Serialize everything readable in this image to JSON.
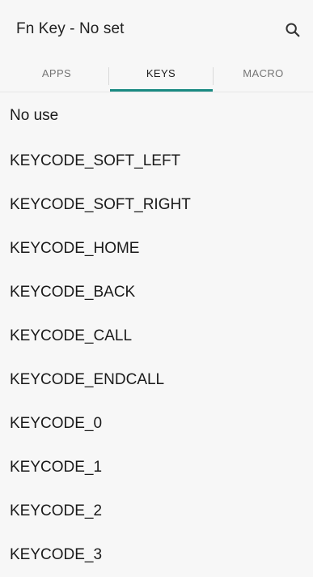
{
  "header": {
    "title": "Fn Key - No set",
    "search_icon": "search-icon"
  },
  "tabs": [
    {
      "label": "APPS",
      "active": false
    },
    {
      "label": "KEYS",
      "active": true
    },
    {
      "label": "MACRO",
      "active": false
    }
  ],
  "colors": {
    "accent": "#1a8a82",
    "background": "#f7f7f7",
    "text_primary": "#1a1a1a",
    "text_secondary": "#757575"
  },
  "keys": [
    "No use",
    "KEYCODE_SOFT_LEFT",
    "KEYCODE_SOFT_RIGHT",
    "KEYCODE_HOME",
    "KEYCODE_BACK",
    "KEYCODE_CALL",
    "KEYCODE_ENDCALL",
    "KEYCODE_0",
    "KEYCODE_1",
    "KEYCODE_2",
    "KEYCODE_3"
  ]
}
